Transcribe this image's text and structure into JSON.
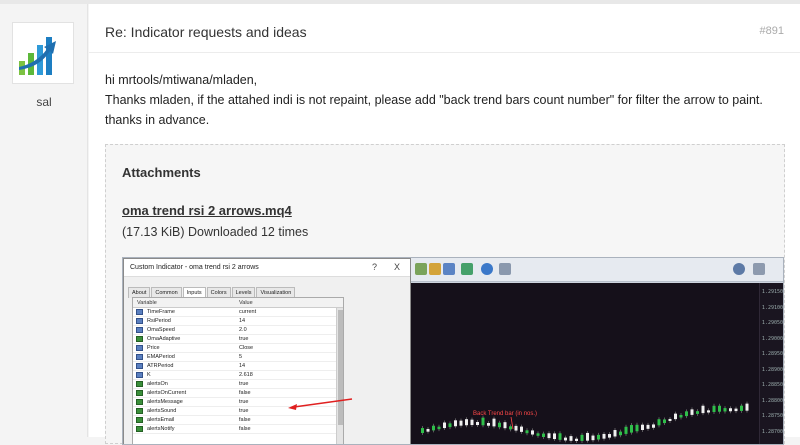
{
  "user": {
    "name": "sal"
  },
  "post": {
    "title": "Re: Indicator requests and ideas",
    "number": "#891",
    "lines": [
      "hi mrtools/mtiwana/mladen,",
      "Thanks mladen, if the attahed indi is not repaint, please add \"back trend bars count number\" for filter the arrow to paint.",
      "thanks in advance."
    ]
  },
  "attachments": {
    "heading": "Attachments",
    "file_name": "oma trend rsi 2 arrows.mq4",
    "file_meta": "(17.13 KiB) Downloaded 12 times"
  },
  "screenshot": {
    "dialog_title": "Custom Indicator - oma trend rsi 2 arrows",
    "dialog_help": "?",
    "dialog_close": "X",
    "tabs": [
      "About",
      "Common",
      "Inputs",
      "Colors",
      "Levels",
      "Visualization"
    ],
    "active_tab": "Inputs",
    "col_variable": "Variable",
    "col_value": "Value",
    "rows": [
      {
        "name": "TimeFrame",
        "value": "current",
        "kind": "num"
      },
      {
        "name": "RsiPeriod",
        "value": "14",
        "kind": "num"
      },
      {
        "name": "OmaSpeed",
        "value": "2.0",
        "kind": "num"
      },
      {
        "name": "OmaAdaptive",
        "value": "true",
        "kind": "bool"
      },
      {
        "name": "Price",
        "value": "Close",
        "kind": "num"
      },
      {
        "name": "EMAPeriod",
        "value": "5",
        "kind": "num"
      },
      {
        "name": "ATRPeriod",
        "value": "14",
        "kind": "num"
      },
      {
        "name": "K",
        "value": "2.618",
        "kind": "num"
      },
      {
        "name": "alertsOn",
        "value": "true",
        "kind": "bool"
      },
      {
        "name": "alertsOnCurrent",
        "value": "false",
        "kind": "bool"
      },
      {
        "name": "alertsMessage",
        "value": "true",
        "kind": "bool"
      },
      {
        "name": "alertsSound",
        "value": "true",
        "kind": "bool"
      },
      {
        "name": "alertsEmail",
        "value": "false",
        "kind": "bool"
      },
      {
        "name": "alertsNotify",
        "value": "false",
        "kind": "bool"
      }
    ],
    "chart_annotation": "Back Trend bar (in nos.)",
    "price_ticks": [
      "1.29150",
      "1.29100",
      "1.29050",
      "1.29000",
      "1.28950",
      "1.28900",
      "1.28850",
      "1.28800",
      "1.28750",
      "1.28700"
    ],
    "accent_arrow_color": "#e02020"
  }
}
